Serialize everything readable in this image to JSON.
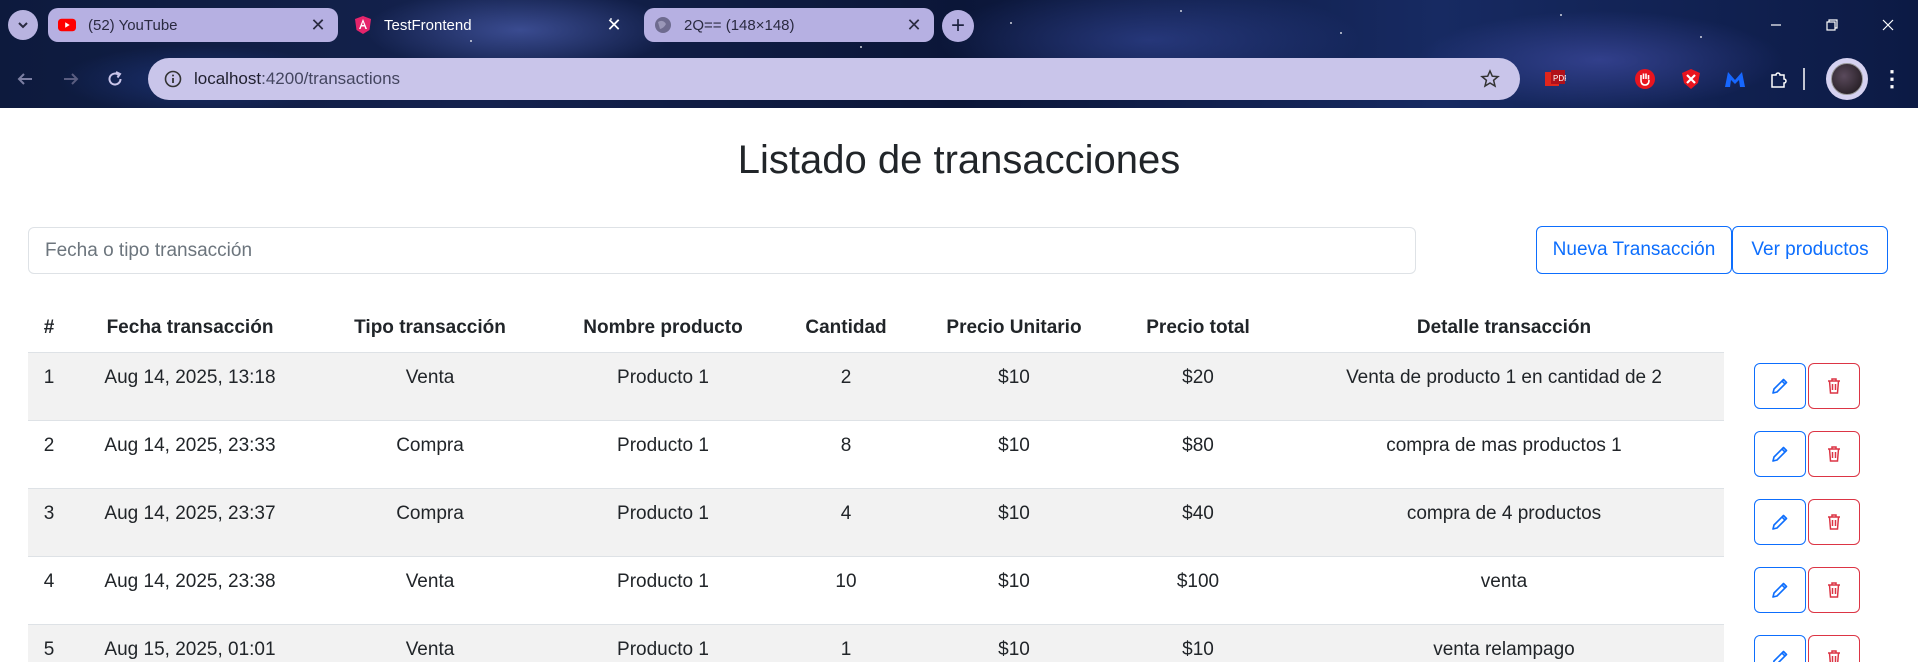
{
  "browser": {
    "tabs": [
      {
        "title": "(52) YouTube",
        "favicon": "youtube-icon",
        "active": false
      },
      {
        "title": "TestFrontend",
        "favicon": "angular-icon",
        "active": true
      },
      {
        "title": "2Q== (148×148)",
        "favicon": "globe-icon",
        "active": false
      }
    ],
    "new_tab_label": "+",
    "url_host": "localhost",
    "url_path": ":4200/transactions",
    "close_glyph": "✕"
  },
  "page": {
    "title": "Listado de transacciones",
    "search_placeholder": "Fecha o tipo transacción",
    "new_transaction_label": "Nueva Transacción",
    "view_products_label": "Ver productos"
  },
  "table": {
    "headers": [
      "#",
      "Fecha transacción",
      "Tipo transacción",
      "Nombre producto",
      "Cantidad",
      "Precio Unitario",
      "Precio total",
      "Detalle transacción"
    ],
    "rows": [
      {
        "id": "1",
        "date": "Aug 14, 2025, 13:18",
        "type": "Venta",
        "product": "Producto 1",
        "qty": "2",
        "unit": "$10",
        "total": "$20",
        "detail": "Venta de producto 1 en cantidad de 2"
      },
      {
        "id": "2",
        "date": "Aug 14, 2025, 23:33",
        "type": "Compra",
        "product": "Producto 1",
        "qty": "8",
        "unit": "$10",
        "total": "$80",
        "detail": "compra de mas productos 1"
      },
      {
        "id": "3",
        "date": "Aug 14, 2025, 23:37",
        "type": "Compra",
        "product": "Producto 1",
        "qty": "4",
        "unit": "$10",
        "total": "$40",
        "detail": "compra de 4 productos"
      },
      {
        "id": "4",
        "date": "Aug 14, 2025, 23:38",
        "type": "Venta",
        "product": "Producto 1",
        "qty": "10",
        "unit": "$10",
        "total": "$100",
        "detail": "venta"
      },
      {
        "id": "5",
        "date": "Aug 15, 2025, 01:01",
        "type": "Venta",
        "product": "Producto 1",
        "qty": "1",
        "unit": "$10",
        "total": "$10",
        "detail": "venta relampago"
      }
    ]
  },
  "colors": {
    "primary": "#0d6efd",
    "danger": "#dc3545",
    "stripe": "#f2f2f2"
  }
}
